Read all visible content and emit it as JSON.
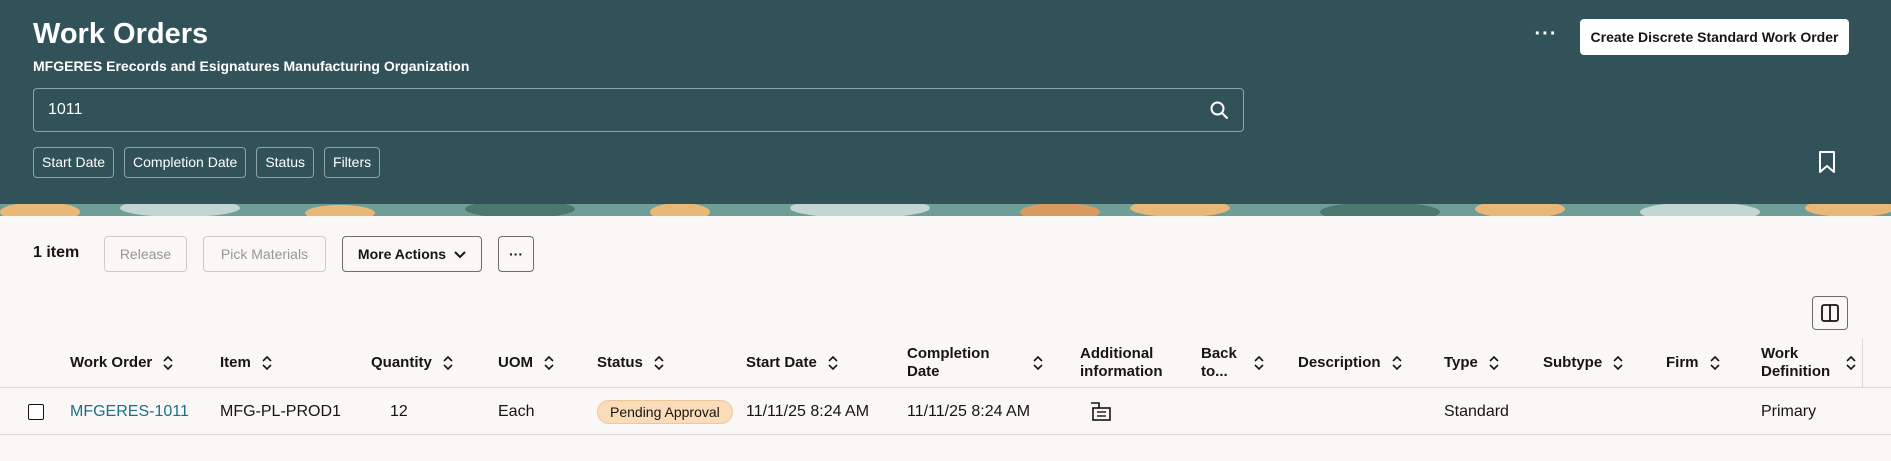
{
  "header": {
    "title": "Work Orders",
    "subtitle": "MFGERES Erecords and Esignatures Manufacturing Organization",
    "more_label": "···",
    "create_label": "Create Discrete Standard Work Order"
  },
  "search": {
    "value": "1011"
  },
  "filters": [
    "Start Date",
    "Completion Date",
    "Status",
    "Filters"
  ],
  "toolbar": {
    "item_count": "1 item",
    "release_label": "Release",
    "pick_materials_label": "Pick Materials",
    "more_actions_label": "More Actions",
    "overflow_label": "···"
  },
  "table": {
    "columns": [
      "Work Order",
      "Item",
      "Quantity",
      "UOM",
      "Status",
      "Start Date",
      "Completion Date",
      "Additional information",
      "Back to...",
      "Description",
      "Type",
      "Subtype",
      "Firm",
      "Work Definition"
    ],
    "rows": [
      {
        "work_order": "MFGERES-1011",
        "item": "MFG-PL-PROD1",
        "quantity": "12",
        "uom": "Each",
        "status": "Pending Approval",
        "start_date": "11/11/25 8:24 AM",
        "completion_date": "11/11/25 8:24 AM",
        "additional_information": "details-icon",
        "back_to": "",
        "description": "",
        "type": "Standard",
        "subtype": "",
        "firm": "",
        "work_definition": "Primary"
      }
    ]
  },
  "colors": {
    "header_bg": "#315259",
    "link": "#1c6f87",
    "badge_bg": "#fbdcb8"
  }
}
